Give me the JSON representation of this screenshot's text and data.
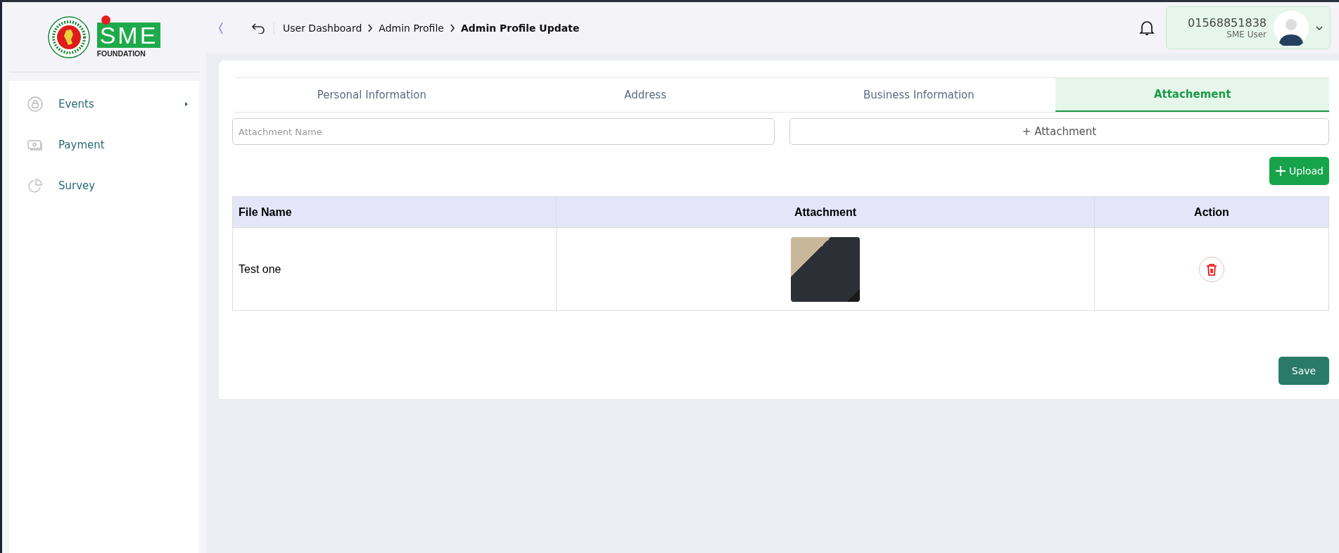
{
  "logo": {
    "mark": "SME",
    "subtitle": "FOUNDATION"
  },
  "breadcrumb": [
    {
      "label": "User Dashboard",
      "current": false
    },
    {
      "label": "Admin Profile",
      "current": false
    },
    {
      "label": "Admin Profile Update",
      "current": true
    }
  ],
  "user": {
    "phone": "01568851838",
    "role": "SME User"
  },
  "sidebar": {
    "items": [
      {
        "label": "Events",
        "kind": "lock",
        "has_children": true
      },
      {
        "label": "Payment",
        "kind": "money",
        "has_children": false
      },
      {
        "label": "Survey",
        "kind": "pie",
        "has_children": false
      }
    ]
  },
  "tabs": [
    {
      "label": "Personal Information",
      "selected": false
    },
    {
      "label": "Address",
      "selected": false
    },
    {
      "label": "Business Information",
      "selected": false
    },
    {
      "label": "Attachement",
      "selected": true
    }
  ],
  "form": {
    "name_placeholder": "Attachment Name",
    "attach_button": "+ Attachment",
    "upload_button": "Upload"
  },
  "table": {
    "columns": [
      "File Name",
      "Attachment",
      "Action"
    ],
    "rows": [
      {
        "file_name": "Test one"
      }
    ]
  },
  "save_button": "Save"
}
